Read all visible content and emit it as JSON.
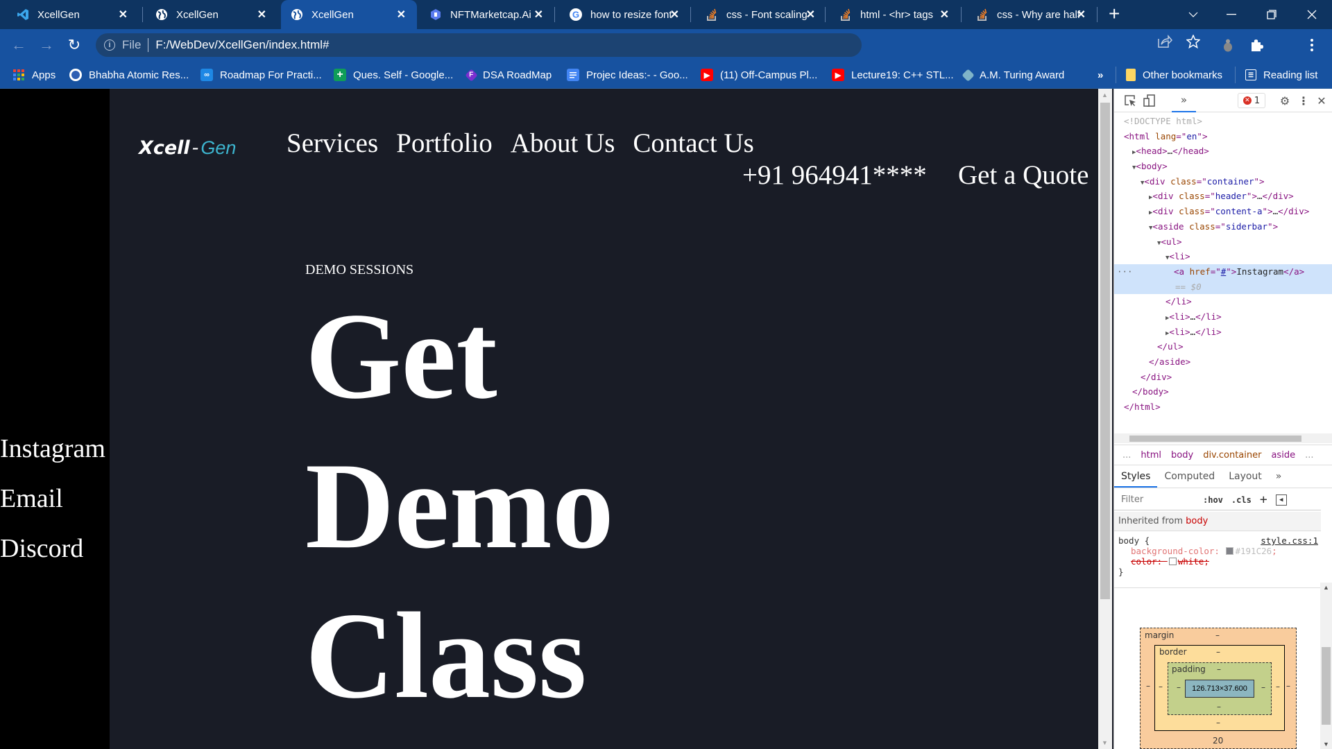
{
  "browser": {
    "tabs": [
      {
        "title": "XcellGen",
        "icon": "vscode-icon",
        "active": false
      },
      {
        "title": "XcellGen",
        "icon": "globe-icon",
        "active": false
      },
      {
        "title": "XcellGen",
        "icon": "globe-icon",
        "active": true
      },
      {
        "title": "NFTMarketcap.Ai",
        "icon": "nftmarketcap-icon",
        "active": false
      },
      {
        "title": "how to resize font",
        "icon": "google-icon",
        "active": false
      },
      {
        "title": "css - Font scaling",
        "icon": "stackoverflow-icon",
        "active": false
      },
      {
        "title": "html - <hr> tags",
        "icon": "stackoverflow-icon",
        "active": false
      },
      {
        "title": "css - Why are half",
        "icon": "stackoverflow-icon",
        "active": false
      }
    ],
    "new_tab": "+",
    "close_glyph": "✕",
    "address": {
      "scheme": "File",
      "url": "F:/WebDev/XcellGen/index.html#"
    },
    "bookmarks": [
      {
        "label": "Apps",
        "icon": "apps-grid-icon"
      },
      {
        "label": "Bhabha Atomic Res...",
        "icon": "barc-icon"
      },
      {
        "label": "Roadmap For Practi...",
        "icon": "infinity-icon"
      },
      {
        "label": "Ques. Self - Google...",
        "icon": "google-sheets-icon"
      },
      {
        "label": "DSA RoadMap",
        "icon": "f-diamond-icon"
      },
      {
        "label": "Projec Ideas:- - Goo...",
        "icon": "google-docs-icon"
      },
      {
        "label": "(11) Off-Campus Pl...",
        "icon": "youtube-icon"
      },
      {
        "label": "Lecture19: C++ STL...",
        "icon": "youtube-icon"
      },
      {
        "label": "A.M. Turing Award",
        "icon": "acm-icon"
      }
    ],
    "bookmarks_overflow": "»",
    "other_bookmarks": "Other bookmarks",
    "reading_list": "Reading list"
  },
  "page": {
    "logo": {
      "part1": "Xcell",
      "dash": "-",
      "part2": "Gen"
    },
    "nav": [
      "Services",
      "Portfolio",
      "About Us",
      "Contact Us"
    ],
    "phone": "+91 964941****",
    "cta": "Get a Quote",
    "kicker": "DEMO SESSIONS",
    "hero": [
      "Get",
      "Demo",
      "Class"
    ],
    "sidebar_links": [
      "Instagram",
      "Email",
      "Discord"
    ],
    "accent_color": "#3DB5CF",
    "background_color": "#191C26"
  },
  "devtools": {
    "error_count": "1",
    "dom_lines": [
      {
        "indent": 0,
        "html": "<!DOCTYPE html>",
        "kind": "doctype"
      },
      {
        "indent": 0,
        "open": "html",
        "attrs": [
          [
            "lang",
            "en"
          ]
        ],
        "tri": ""
      },
      {
        "indent": 1,
        "open": "head",
        "collapsed": true,
        "tri": "▶"
      },
      {
        "indent": 1,
        "open": "body",
        "tri": "▼"
      },
      {
        "indent": 2,
        "open": "div",
        "attrs": [
          [
            "class",
            "container"
          ]
        ],
        "tri": "▼"
      },
      {
        "indent": 3,
        "open": "div",
        "attrs": [
          [
            "class",
            "header"
          ]
        ],
        "collapsed": true,
        "tri": "▶"
      },
      {
        "indent": 3,
        "open": "div",
        "attrs": [
          [
            "class",
            "content-a"
          ]
        ],
        "collapsed": true,
        "tri": "▶"
      },
      {
        "indent": 3,
        "open": "aside",
        "attrs": [
          [
            "class",
            "siderbar"
          ]
        ],
        "tri": "▼"
      },
      {
        "indent": 4,
        "open": "ul",
        "tri": "▼"
      },
      {
        "indent": 5,
        "open": "li",
        "tri": "▼"
      },
      {
        "indent": 6,
        "anchor": true,
        "href": "#",
        "text": "Instagram",
        "selected": true
      },
      {
        "indent": 6,
        "eq": "== $0",
        "selected": true
      },
      {
        "indent": 5,
        "close": "li"
      },
      {
        "indent": 5,
        "open": "li",
        "collapsed": true,
        "tri": "▶"
      },
      {
        "indent": 5,
        "open": "li",
        "collapsed": true,
        "tri": "▶"
      },
      {
        "indent": 4,
        "close": "ul"
      },
      {
        "indent": 3,
        "close": "aside"
      },
      {
        "indent": 2,
        "close": "div"
      },
      {
        "indent": 1,
        "close": "body"
      },
      {
        "indent": 0,
        "close": "html"
      }
    ],
    "breadcrumbs": [
      "...",
      "html",
      "body",
      "div.container",
      "aside",
      "..."
    ],
    "style_tabs": [
      "Styles",
      "Computed",
      "Layout",
      "»"
    ],
    "filter_placeholder": "Filter",
    "hov": ":hov",
    "cls": ".cls",
    "inherited_label": "Inherited from",
    "inherited_from": "body",
    "rule": {
      "selector": "body {",
      "source": "style.css:1",
      "props": [
        {
          "name": "background-color",
          "value": "#191C26",
          "swatch": "#191C26",
          "struck": false
        },
        {
          "name": "color",
          "value": "white",
          "swatch": "#ffffff",
          "struck": true
        }
      ],
      "close": "}"
    },
    "box_model": {
      "margin_label": "margin",
      "border_label": "border",
      "padding_label": "padding",
      "content": "126.713×37.600",
      "margin_bottom": "20",
      "dash": "–"
    }
  }
}
